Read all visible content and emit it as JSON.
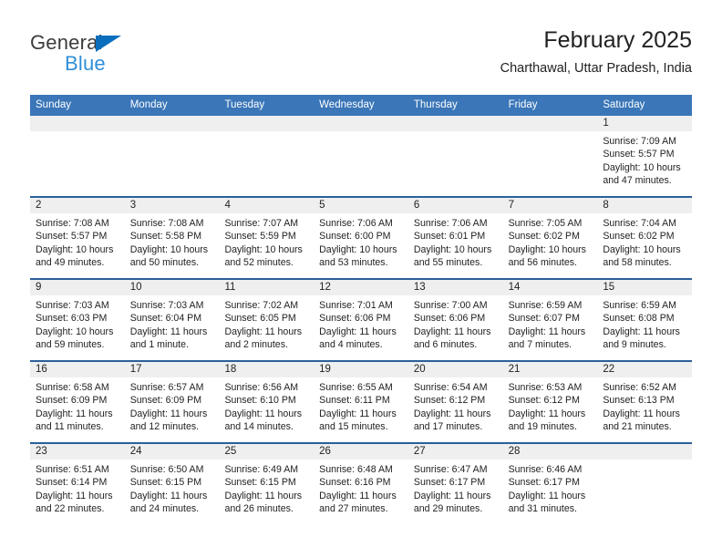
{
  "brand": {
    "name_part1": "General",
    "name_part2": "Blue",
    "triangle_color": "#0a6ebd",
    "blue_color": "#2f8fd8"
  },
  "header": {
    "title": "February 2025",
    "subtitle": "Charthawal, Uttar Pradesh, India"
  },
  "theme": {
    "header_blue": "#3a76b8",
    "row_divider_blue": "#2a6099",
    "day_band_gray": "#efefef",
    "text_color": "#222222"
  },
  "weekdays": [
    "Sunday",
    "Monday",
    "Tuesday",
    "Wednesday",
    "Thursday",
    "Friday",
    "Saturday"
  ],
  "weeks": [
    [
      {
        "day": "",
        "sunrise": "",
        "sunset": "",
        "daylight": "",
        "empty": true
      },
      {
        "day": "",
        "sunrise": "",
        "sunset": "",
        "daylight": "",
        "empty": true
      },
      {
        "day": "",
        "sunrise": "",
        "sunset": "",
        "daylight": "",
        "empty": true
      },
      {
        "day": "",
        "sunrise": "",
        "sunset": "",
        "daylight": "",
        "empty": true
      },
      {
        "day": "",
        "sunrise": "",
        "sunset": "",
        "daylight": "",
        "empty": true
      },
      {
        "day": "",
        "sunrise": "",
        "sunset": "",
        "daylight": "",
        "empty": true
      },
      {
        "day": "1",
        "sunrise": "Sunrise: 7:09 AM",
        "sunset": "Sunset: 5:57 PM",
        "daylight": "Daylight: 10 hours and 47 minutes.",
        "empty": false
      }
    ],
    [
      {
        "day": "2",
        "sunrise": "Sunrise: 7:08 AM",
        "sunset": "Sunset: 5:57 PM",
        "daylight": "Daylight: 10 hours and 49 minutes.",
        "empty": false
      },
      {
        "day": "3",
        "sunrise": "Sunrise: 7:08 AM",
        "sunset": "Sunset: 5:58 PM",
        "daylight": "Daylight: 10 hours and 50 minutes.",
        "empty": false
      },
      {
        "day": "4",
        "sunrise": "Sunrise: 7:07 AM",
        "sunset": "Sunset: 5:59 PM",
        "daylight": "Daylight: 10 hours and 52 minutes.",
        "empty": false
      },
      {
        "day": "5",
        "sunrise": "Sunrise: 7:06 AM",
        "sunset": "Sunset: 6:00 PM",
        "daylight": "Daylight: 10 hours and 53 minutes.",
        "empty": false
      },
      {
        "day": "6",
        "sunrise": "Sunrise: 7:06 AM",
        "sunset": "Sunset: 6:01 PM",
        "daylight": "Daylight: 10 hours and 55 minutes.",
        "empty": false
      },
      {
        "day": "7",
        "sunrise": "Sunrise: 7:05 AM",
        "sunset": "Sunset: 6:02 PM",
        "daylight": "Daylight: 10 hours and 56 minutes.",
        "empty": false
      },
      {
        "day": "8",
        "sunrise": "Sunrise: 7:04 AM",
        "sunset": "Sunset: 6:02 PM",
        "daylight": "Daylight: 10 hours and 58 minutes.",
        "empty": false
      }
    ],
    [
      {
        "day": "9",
        "sunrise": "Sunrise: 7:03 AM",
        "sunset": "Sunset: 6:03 PM",
        "daylight": "Daylight: 10 hours and 59 minutes.",
        "empty": false
      },
      {
        "day": "10",
        "sunrise": "Sunrise: 7:03 AM",
        "sunset": "Sunset: 6:04 PM",
        "daylight": "Daylight: 11 hours and 1 minute.",
        "empty": false
      },
      {
        "day": "11",
        "sunrise": "Sunrise: 7:02 AM",
        "sunset": "Sunset: 6:05 PM",
        "daylight": "Daylight: 11 hours and 2 minutes.",
        "empty": false
      },
      {
        "day": "12",
        "sunrise": "Sunrise: 7:01 AM",
        "sunset": "Sunset: 6:06 PM",
        "daylight": "Daylight: 11 hours and 4 minutes.",
        "empty": false
      },
      {
        "day": "13",
        "sunrise": "Sunrise: 7:00 AM",
        "sunset": "Sunset: 6:06 PM",
        "daylight": "Daylight: 11 hours and 6 minutes.",
        "empty": false
      },
      {
        "day": "14",
        "sunrise": "Sunrise: 6:59 AM",
        "sunset": "Sunset: 6:07 PM",
        "daylight": "Daylight: 11 hours and 7 minutes.",
        "empty": false
      },
      {
        "day": "15",
        "sunrise": "Sunrise: 6:59 AM",
        "sunset": "Sunset: 6:08 PM",
        "daylight": "Daylight: 11 hours and 9 minutes.",
        "empty": false
      }
    ],
    [
      {
        "day": "16",
        "sunrise": "Sunrise: 6:58 AM",
        "sunset": "Sunset: 6:09 PM",
        "daylight": "Daylight: 11 hours and 11 minutes.",
        "empty": false
      },
      {
        "day": "17",
        "sunrise": "Sunrise: 6:57 AM",
        "sunset": "Sunset: 6:09 PM",
        "daylight": "Daylight: 11 hours and 12 minutes.",
        "empty": false
      },
      {
        "day": "18",
        "sunrise": "Sunrise: 6:56 AM",
        "sunset": "Sunset: 6:10 PM",
        "daylight": "Daylight: 11 hours and 14 minutes.",
        "empty": false
      },
      {
        "day": "19",
        "sunrise": "Sunrise: 6:55 AM",
        "sunset": "Sunset: 6:11 PM",
        "daylight": "Daylight: 11 hours and 15 minutes.",
        "empty": false
      },
      {
        "day": "20",
        "sunrise": "Sunrise: 6:54 AM",
        "sunset": "Sunset: 6:12 PM",
        "daylight": "Daylight: 11 hours and 17 minutes.",
        "empty": false
      },
      {
        "day": "21",
        "sunrise": "Sunrise: 6:53 AM",
        "sunset": "Sunset: 6:12 PM",
        "daylight": "Daylight: 11 hours and 19 minutes.",
        "empty": false
      },
      {
        "day": "22",
        "sunrise": "Sunrise: 6:52 AM",
        "sunset": "Sunset: 6:13 PM",
        "daylight": "Daylight: 11 hours and 21 minutes.",
        "empty": false
      }
    ],
    [
      {
        "day": "23",
        "sunrise": "Sunrise: 6:51 AM",
        "sunset": "Sunset: 6:14 PM",
        "daylight": "Daylight: 11 hours and 22 minutes.",
        "empty": false
      },
      {
        "day": "24",
        "sunrise": "Sunrise: 6:50 AM",
        "sunset": "Sunset: 6:15 PM",
        "daylight": "Daylight: 11 hours and 24 minutes.",
        "empty": false
      },
      {
        "day": "25",
        "sunrise": "Sunrise: 6:49 AM",
        "sunset": "Sunset: 6:15 PM",
        "daylight": "Daylight: 11 hours and 26 minutes.",
        "empty": false
      },
      {
        "day": "26",
        "sunrise": "Sunrise: 6:48 AM",
        "sunset": "Sunset: 6:16 PM",
        "daylight": "Daylight: 11 hours and 27 minutes.",
        "empty": false
      },
      {
        "day": "27",
        "sunrise": "Sunrise: 6:47 AM",
        "sunset": "Sunset: 6:17 PM",
        "daylight": "Daylight: 11 hours and 29 minutes.",
        "empty": false
      },
      {
        "day": "28",
        "sunrise": "Sunrise: 6:46 AM",
        "sunset": "Sunset: 6:17 PM",
        "daylight": "Daylight: 11 hours and 31 minutes.",
        "empty": false
      },
      {
        "day": "",
        "sunrise": "",
        "sunset": "",
        "daylight": "",
        "empty": true
      }
    ]
  ]
}
